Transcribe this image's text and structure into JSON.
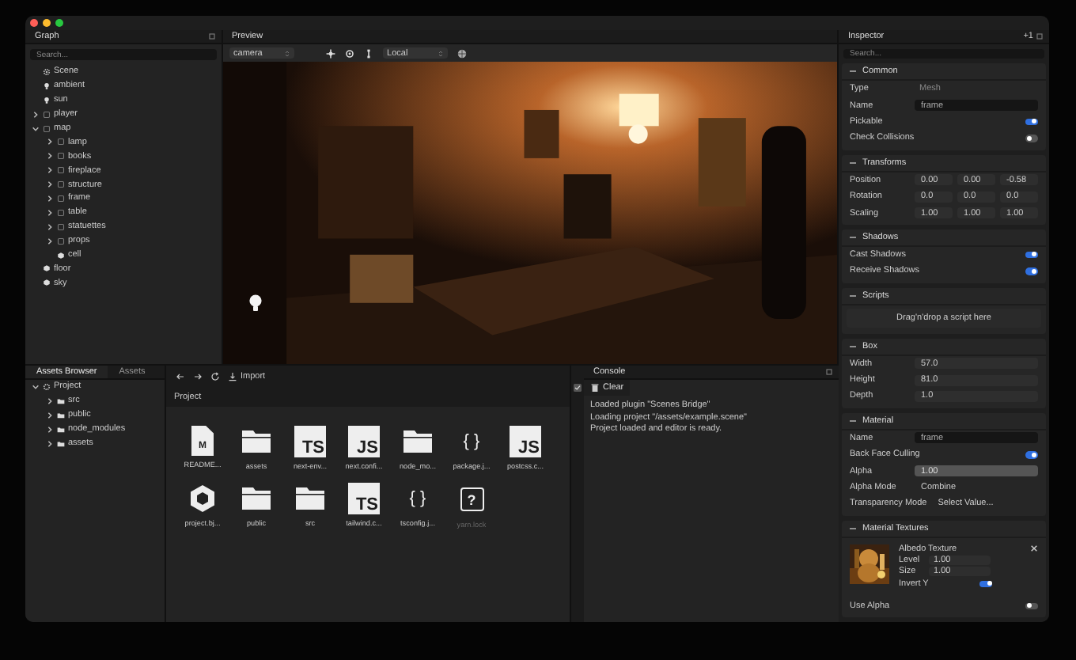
{
  "graph": {
    "title": "Graph",
    "search": {
      "placeholder": "Search..."
    },
    "tree": [
      {
        "label": "Scene",
        "kind": "scene"
      },
      {
        "label": "ambient",
        "kind": "light"
      },
      {
        "label": "sun",
        "kind": "light"
      },
      {
        "label": "player",
        "kind": "node",
        "expanded": false
      },
      {
        "label": "map",
        "kind": "node",
        "expanded": true,
        "children": [
          {
            "label": "lamp",
            "kind": "node",
            "expanded": false
          },
          {
            "label": "books",
            "kind": "node",
            "expanded": false
          },
          {
            "label": "fireplace",
            "kind": "node",
            "expanded": false
          },
          {
            "label": "structure",
            "kind": "node",
            "expanded": false
          },
          {
            "label": "frame",
            "kind": "node",
            "expanded": false
          },
          {
            "label": "table",
            "kind": "node",
            "expanded": false
          },
          {
            "label": "statuettes",
            "kind": "node",
            "expanded": false
          },
          {
            "label": "props",
            "kind": "node",
            "expanded": false
          },
          {
            "label": "cell",
            "kind": "mesh"
          }
        ]
      },
      {
        "label": "floor",
        "kind": "mesh"
      },
      {
        "label": "sky",
        "kind": "mesh"
      }
    ]
  },
  "preview": {
    "title": "Preview",
    "camera_select": "camera",
    "space_select": "Local"
  },
  "assets": {
    "tabs": [
      {
        "label": "Assets Browser",
        "selected": true
      },
      {
        "label": "Assets",
        "selected": false
      }
    ],
    "tree": [
      {
        "label": "Project",
        "kind": "project",
        "expanded": true,
        "children": [
          {
            "label": "src",
            "kind": "folder",
            "expanded": false
          },
          {
            "label": "public",
            "kind": "folder",
            "expanded": false
          },
          {
            "label": "node_modules",
            "kind": "folder",
            "expanded": false
          },
          {
            "label": "assets",
            "kind": "folder",
            "expanded": false
          }
        ]
      }
    ],
    "import_button": "Import",
    "breadcrumb": "Project",
    "files": [
      {
        "name": "README...",
        "kind": "markdown",
        "glyph": "M",
        "dimmed": false
      },
      {
        "name": "assets",
        "kind": "folder",
        "dimmed": false
      },
      {
        "name": "next-env...",
        "kind": "code",
        "glyph": "TS",
        "dimmed": false
      },
      {
        "name": "next.confi...",
        "kind": "code",
        "glyph": "JS",
        "dimmed": false
      },
      {
        "name": "node_mo...",
        "kind": "folder",
        "dimmed": false
      },
      {
        "name": "package.j...",
        "kind": "json",
        "glyph": "{ }",
        "dimmed": false
      },
      {
        "name": "postcss.c...",
        "kind": "code",
        "glyph": "JS",
        "dimmed": false
      },
      {
        "name": "project.bj...",
        "kind": "project",
        "dimmed": false
      },
      {
        "name": "public",
        "kind": "folder",
        "dimmed": false
      },
      {
        "name": "src",
        "kind": "folder",
        "dimmed": false
      },
      {
        "name": "tailwind.c...",
        "kind": "code",
        "glyph": "TS",
        "dimmed": false
      },
      {
        "name": "tsconfig.j...",
        "kind": "json",
        "glyph": "{ }",
        "dimmed": false
      },
      {
        "name": "yarn.lock",
        "kind": "unknown",
        "glyph": "?",
        "dimmed": true
      }
    ]
  },
  "console": {
    "title": "Console",
    "clear_button": "Clear",
    "lines": [
      "Loaded plugin \"Scenes Bridge\"",
      "Loading project \"/assets/example.scene\"",
      "Project loaded and editor is ready."
    ]
  },
  "inspector": {
    "title": "Inspector",
    "badge": "+1",
    "search": {
      "placeholder": "Search..."
    },
    "sections": [
      {
        "title": "Common",
        "rows": [
          {
            "kind": "text",
            "label": "Type",
            "value": "Mesh"
          },
          {
            "kind": "input",
            "label": "Name",
            "value": "frame"
          },
          {
            "kind": "toggle",
            "label": "Pickable",
            "on": true
          },
          {
            "kind": "toggle",
            "label": "Check Collisions",
            "on": false
          }
        ]
      },
      {
        "title": "Transforms",
        "rows": [
          {
            "kind": "vector",
            "label": "Position",
            "values": [
              "0.00",
              "0.00",
              "-0.58"
            ]
          },
          {
            "kind": "vector",
            "label": "Rotation",
            "values": [
              "0.0",
              "0.0",
              "0.0"
            ]
          },
          {
            "kind": "vector",
            "label": "Scaling",
            "values": [
              "1.00",
              "1.00",
              "1.00"
            ]
          }
        ]
      },
      {
        "title": "Shadows",
        "rows": [
          {
            "kind": "toggle",
            "label": "Cast Shadows",
            "on": true
          },
          {
            "kind": "toggle",
            "label": "Receive Shadows",
            "on": true
          }
        ]
      },
      {
        "title": "Scripts",
        "rows": [
          {
            "kind": "dropzone",
            "text": "Drag'n'drop a script here"
          }
        ]
      },
      {
        "title": "Box",
        "rows": [
          {
            "kind": "number",
            "label": "Width",
            "value": "57.0"
          },
          {
            "kind": "number",
            "label": "Height",
            "value": "81.0"
          },
          {
            "kind": "number",
            "label": "Depth",
            "value": "1.0"
          }
        ]
      },
      {
        "title": "Material",
        "rows": [
          {
            "kind": "input",
            "label": "Name",
            "value": "frame"
          },
          {
            "kind": "toggle",
            "label": "Back Face Culling",
            "on": true
          },
          {
            "kind": "slider",
            "label": "Alpha",
            "value": "1.00"
          },
          {
            "kind": "select",
            "label": "Alpha Mode",
            "value": "Combine"
          },
          {
            "kind": "select",
            "label": "Transparency Mode",
            "value": "Select Value..."
          }
        ]
      },
      {
        "title": "Material Textures",
        "rows": [
          {
            "kind": "texture",
            "title": "Albedo Texture",
            "fields": [
              {
                "label": "Level",
                "value": "1.00"
              },
              {
                "label": "Size",
                "value": "1.00"
              }
            ],
            "toggle": {
              "label": "Invert Y",
              "on": true
            }
          },
          {
            "kind": "toggle",
            "label": "Use Alpha",
            "on": false
          }
        ]
      }
    ]
  }
}
